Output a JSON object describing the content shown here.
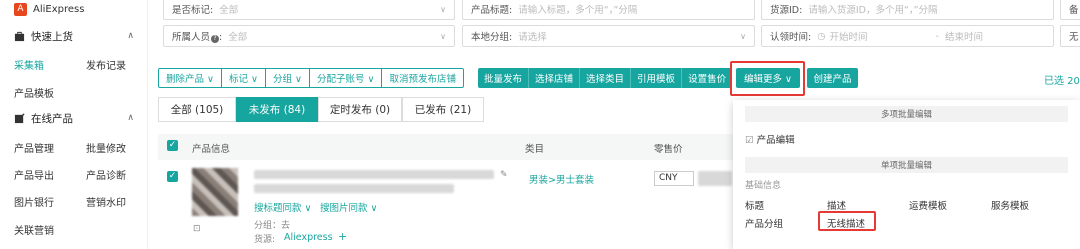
{
  "sidebar": {
    "app_name": "AliExpress",
    "groups": [
      {
        "label": "快速上货",
        "items": [
          [
            "采集箱",
            "发布记录"
          ],
          [
            "产品模板",
            ""
          ]
        ]
      },
      {
        "label": "在线产品",
        "items": [
          [
            "产品管理",
            "批量修改"
          ],
          [
            "产品导出",
            "产品诊断"
          ],
          [
            "图片银行",
            "营销水印"
          ],
          [
            "关联营销",
            ""
          ]
        ]
      }
    ]
  },
  "filters": {
    "row1": [
      {
        "label": "是否标记:",
        "placeholder": "全部"
      },
      {
        "label": "产品标题:",
        "placeholder": "请输入标题，多个用“，”分隔"
      },
      {
        "label": "货源ID:",
        "placeholder": "请输入货源ID，多个用“，”分隔"
      },
      {
        "label": "备",
        "placeholder": ""
      }
    ],
    "row2": [
      {
        "label": "所属人员",
        "placeholder": "全部"
      },
      {
        "label": "本地分组:",
        "placeholder": "请选择"
      },
      {
        "label": "认领时间:",
        "start": "开始时间",
        "sep": "-",
        "end": "结束时间"
      },
      {
        "label": "无",
        "placeholder": ""
      }
    ]
  },
  "toolbar": {
    "outline_buttons": [
      "删除产品 ∨",
      "标记 ∨",
      "分组 ∨",
      "分配子账号 ∨",
      "取消预发布店铺"
    ],
    "solid_buttons": [
      "批量发布",
      "选择店铺",
      "选择类目",
      "引用模板",
      "设置售价"
    ],
    "more_button": "编辑更多 ∨",
    "create_button": "创建产品",
    "selected_count": "已选 20"
  },
  "tabs": [
    {
      "label": "全部 (105)",
      "active": false
    },
    {
      "label": "未发布 (84)",
      "active": true
    },
    {
      "label": "定时发布 (0)",
      "active": false
    },
    {
      "label": "已发布 (21)",
      "active": false
    }
  ],
  "table": {
    "headers": [
      "产品信息",
      "类目",
      "零售价"
    ],
    "row": {
      "search_same_title": "搜标题同款",
      "search_same_image": "搜图片同款",
      "group": "分组：去",
      "source_label": "货源:",
      "source_value": "Aliexpress",
      "category": "男装>男士套装",
      "currency": "CNY"
    }
  },
  "dropdown": {
    "section_multi": "多项批量编辑",
    "product_edit": "产品编辑",
    "section_single": "单项批量编辑",
    "basic_info": "基础信息",
    "items_row1": [
      "标题",
      "描述",
      "运费模板",
      "服务模板"
    ],
    "items_row2": [
      "产品分组",
      "无线描述"
    ]
  },
  "colors": {
    "accent": "#17a5a0",
    "highlight": "#e53935",
    "brand": "#e8461e"
  }
}
